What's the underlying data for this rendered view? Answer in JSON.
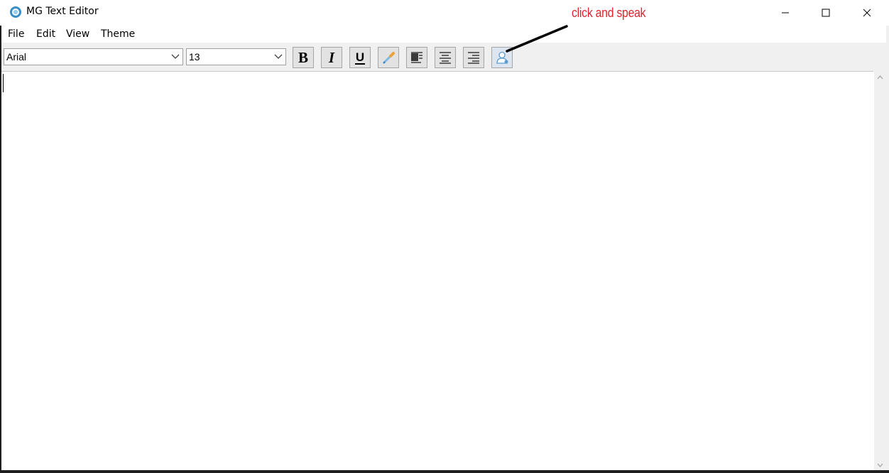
{
  "window": {
    "title": "MG Text Editor",
    "app_icon": "mg-editor-icon",
    "controls": [
      "minimize-icon",
      "maximize-icon",
      "close-icon"
    ]
  },
  "annotation": {
    "text": "click and speak",
    "color": "#e0242e"
  },
  "menu": {
    "items": [
      "File",
      "Edit",
      "View",
      "Theme"
    ]
  },
  "toolbar": {
    "font_family": "Arial",
    "font_size": "13",
    "buttons": [
      "bold-icon",
      "italic-icon",
      "underline-icon",
      "color-picker-icon",
      "align-left-icon",
      "align-center-icon",
      "align-right-icon",
      "speech-to-text-icon"
    ]
  },
  "editor": {
    "content": ""
  }
}
